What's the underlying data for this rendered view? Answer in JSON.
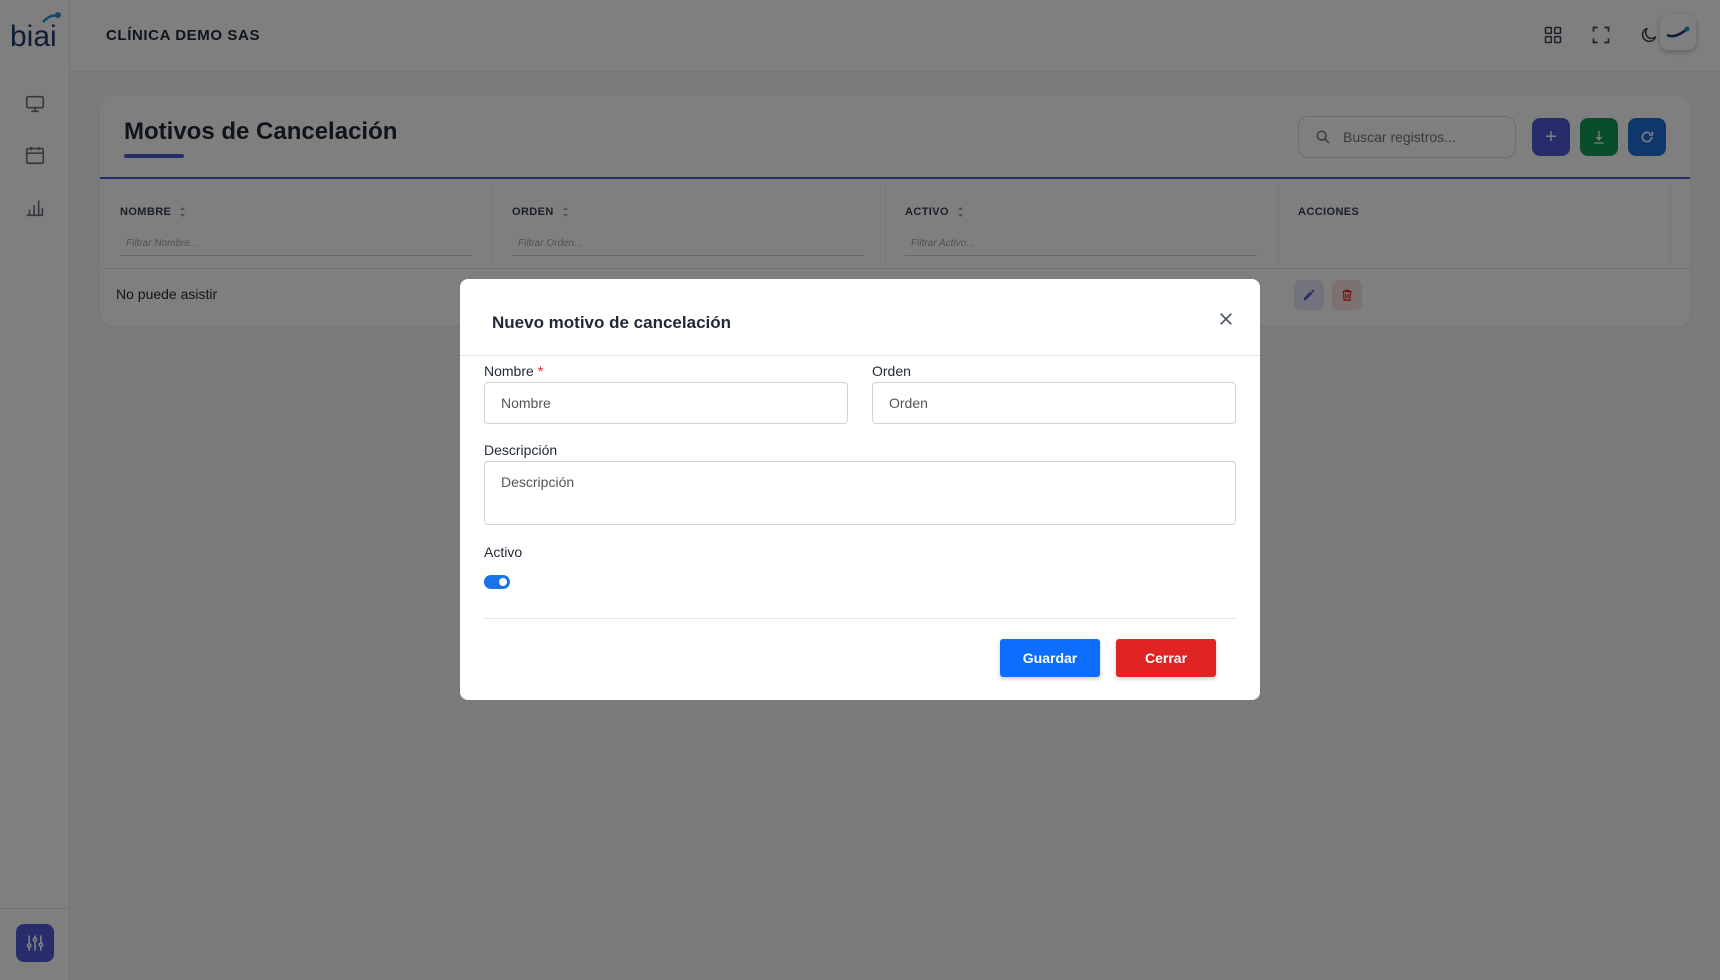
{
  "brand": {
    "logo_text": "biai"
  },
  "topbar": {
    "clinic_name": "CLÍNICA DEMO SAS",
    "icons": [
      "apps-grid-icon",
      "fullscreen-icon",
      "moon-icon",
      "avatar-logo"
    ]
  },
  "sidebar": {
    "items": [
      {
        "icon": "monitor-icon"
      },
      {
        "icon": "calendar-icon"
      },
      {
        "icon": "bar-chart-icon"
      }
    ],
    "bottom_icon": "sliders-icon"
  },
  "page": {
    "title": "Motivos de Cancelación",
    "search_placeholder": "Buscar registros...",
    "toolbar": [
      {
        "name": "add",
        "icon": "+",
        "color": "#4f5bd5"
      },
      {
        "name": "download",
        "icon": "download-icon",
        "color": "#109c5a"
      },
      {
        "name": "refresh",
        "icon": "refresh-icon",
        "color": "#1f6fd6"
      }
    ]
  },
  "table": {
    "columns": [
      {
        "label": "NOMBRE",
        "filter": "Filtrar Nombre..."
      },
      {
        "label": "ORDEN",
        "filter": "Filtrar Orden..."
      },
      {
        "label": "ACTIVO",
        "filter": "Filtrar Activo..."
      },
      {
        "label": "ACCIONES",
        "filter": ""
      }
    ],
    "rows": [
      {
        "nombre": "No puede asistir"
      }
    ]
  },
  "modal": {
    "title": "Nuevo motivo de cancelación",
    "fields": {
      "nombre": {
        "label": "Nombre",
        "required_mark": "*",
        "placeholder": "Nombre",
        "value": ""
      },
      "orden": {
        "label": "Orden",
        "placeholder": "Orden",
        "value": ""
      },
      "descripcion": {
        "label": "Descripción",
        "placeholder": "Descripción",
        "value": ""
      },
      "activo": {
        "label": "Activo",
        "checked": true
      }
    },
    "buttons": {
      "save": {
        "label": "Guardar",
        "color": "#0d6efd"
      },
      "close": {
        "label": "Cerrar",
        "color": "#e02424"
      }
    }
  },
  "colors": {
    "accent": "#4f5bd5",
    "toggle_on": "#1a73e8"
  }
}
